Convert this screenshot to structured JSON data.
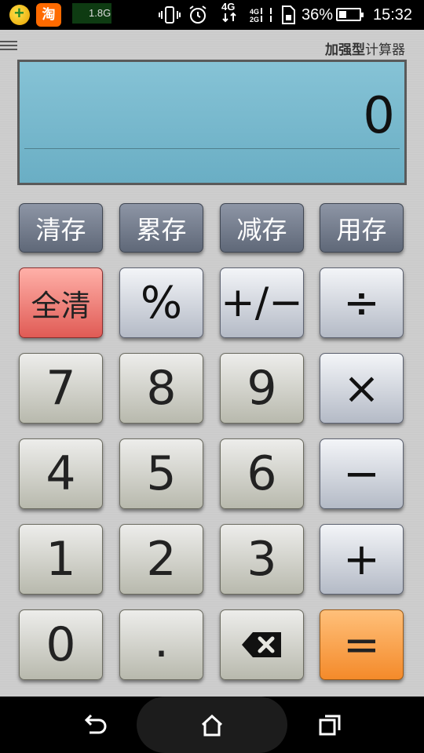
{
  "status_bar": {
    "app2_label": "淘",
    "memory": "1.8G",
    "network_top": "4G",
    "network_side": "4G",
    "network_side2": "2G",
    "battery_percent": "36%",
    "battery_level": 0.36,
    "time": "15:32",
    "icons": [
      "app-icon",
      "taobao-icon",
      "vibrate-icon",
      "alarm-icon",
      "4g-data-icon",
      "signal-icon",
      "battery-icon"
    ]
  },
  "app": {
    "title_bold": "加强型",
    "title_rest": "计算器",
    "display_value": "0"
  },
  "memory_buttons": [
    "清存",
    "累存",
    "减存",
    "用存"
  ],
  "row1": {
    "clear": "全清",
    "percent": "%",
    "sign": "+/−",
    "divide": "÷"
  },
  "row2": {
    "seven": "7",
    "eight": "8",
    "nine": "9",
    "multiply": "×"
  },
  "row3": {
    "four": "4",
    "five": "5",
    "six": "6",
    "minus": "−"
  },
  "row4": {
    "one": "1",
    "two": "2",
    "three": "3",
    "plus": "+"
  },
  "row5": {
    "zero": "0",
    "decimal": ".",
    "backspace_icon": "backspace-icon",
    "equals": "="
  },
  "navbar": {
    "icons": [
      "back-icon",
      "home-icon",
      "recents-icon"
    ]
  }
}
